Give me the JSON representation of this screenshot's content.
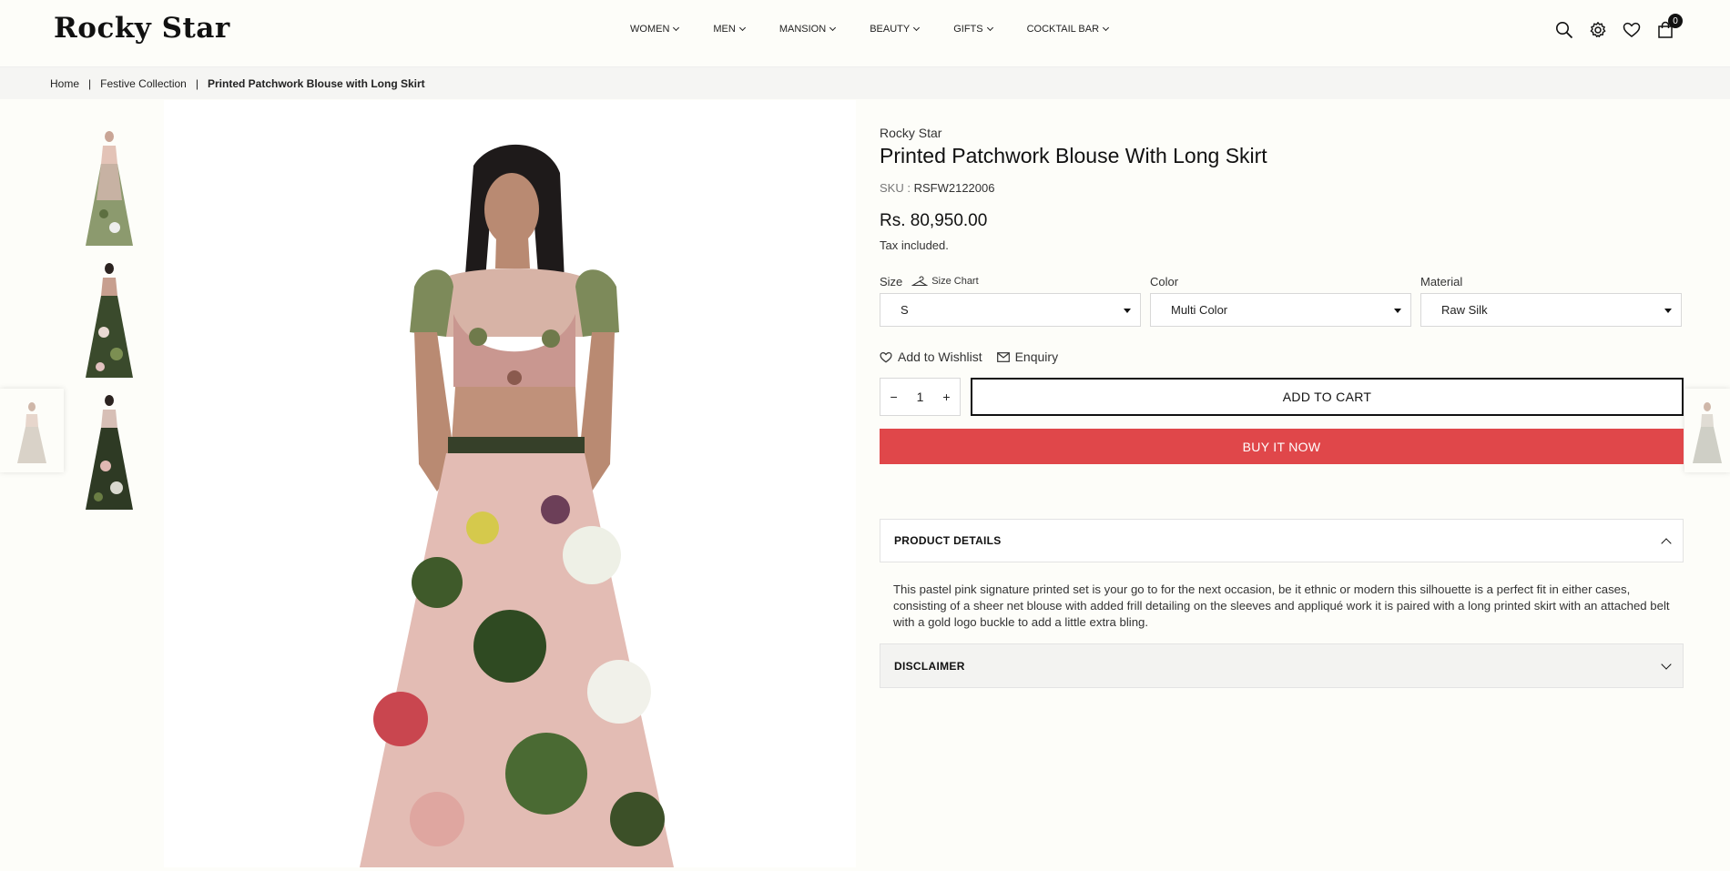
{
  "header": {
    "logo": "Rocky Star",
    "nav": [
      {
        "label": "WOMEN"
      },
      {
        "label": "MEN"
      },
      {
        "label": "MANSION"
      },
      {
        "label": "BEAUTY"
      },
      {
        "label": "GIFTS"
      },
      {
        "label": "COCKTAIL BAR"
      }
    ],
    "cart_count": "0"
  },
  "breadcrumb": {
    "home": "Home",
    "collection": "Festive Collection",
    "current": "Printed Patchwork Blouse with Long Skirt",
    "sep": "|"
  },
  "product": {
    "brand": "Rocky Star",
    "title": "Printed Patchwork Blouse With Long Skirt",
    "sku_label": "SKU :",
    "sku": "RSFW2122006",
    "price": "Rs. 80,950.00",
    "tax_note": "Tax included.",
    "options": {
      "size_label": "Size",
      "size_chart": "Size Chart",
      "size_value": "S",
      "color_label": "Color",
      "color_value": "Multi Color",
      "material_label": "Material",
      "material_value": "Raw Silk"
    },
    "wishlist": "Add to Wishlist",
    "enquiry": "Enquiry",
    "quantity": "1",
    "minus": "−",
    "plus": "+",
    "add_to_cart": "ADD TO CART",
    "buy_now": "BUY IT NOW",
    "details_title": "PRODUCT DETAILS",
    "description": "This pastel pink signature printed set is your go to for the next occasion, be it ethnic or modern this silhouette is a perfect fit in either cases, consisting of a sheer net blouse with added frill detailing on the sleeves and appliqué work it is paired with a long printed skirt with an attached belt with a gold logo buckle to add a little extra bling.",
    "disclaimer_title": "DISCLAIMER"
  },
  "colors": {
    "buy_now": "#e0474a",
    "accent_text": "#111111"
  }
}
